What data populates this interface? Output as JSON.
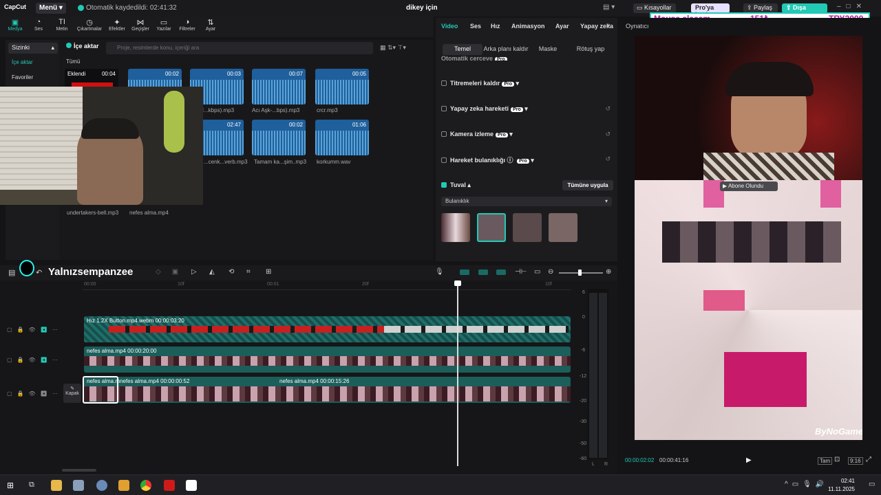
{
  "app": {
    "logo": "CapCut",
    "menu_label": "Menü",
    "autosave": "Otomatik kaydedildi: 02:41:32",
    "project_title": "dikey için"
  },
  "toolbar": {
    "items": [
      "Medya",
      "Ses",
      "Metin",
      "Çıkartmalar",
      "Efektler",
      "Geçişler",
      "Yazılar",
      "Filtreler",
      "Ayar"
    ]
  },
  "leftnav": {
    "selected": "Sizinki",
    "items": [
      "İçe aktar",
      "Favoriler"
    ]
  },
  "media": {
    "import_label": "İçe aktar",
    "search_placeholder": "Proje, resimlerde konu, içeriği ara",
    "filter_all": "Tümü",
    "items": [
      {
        "name": "",
        "duration": "00:04",
        "added": "Eklendi"
      },
      {
        "name": "...on I...kbps).mp3",
        "duration": "00:02"
      },
      {
        "name": "",
        "duration": "00:03"
      },
      {
        "name": "Acı Aşk-...bps).mp3",
        "duration": "00:07"
      },
      {
        "name": "crcr.mp3",
        "duration": "00:05"
      },
      {
        "name": "...cenk...verb.mp3",
        "duration": "02:47"
      },
      {
        "name": "Tamam ka...şim..mp3",
        "duration": "00:02"
      },
      {
        "name": "korkumm.wav",
        "duration": "01:06"
      },
      {
        "name": "undertakers-bell.mp3",
        "duration": ""
      },
      {
        "name": "nefes alma.mp4",
        "duration": ""
      }
    ]
  },
  "right": {
    "tabs": [
      "Video",
      "Ses",
      "Hız",
      "Animasyon",
      "Ayar",
      "Yapay zeka"
    ],
    "subtabs": [
      "Temel",
      "Arka planı kaldır",
      "Maske",
      "Rötuş yap"
    ],
    "options": [
      "Otomatik çerçeve",
      "Titremeleri kaldır",
      "Yapay zeka hareketi",
      "Kamera izleme",
      "Hareket bulanıklığı",
      "Tuval"
    ],
    "pro_badge": "Pro",
    "apply_all": "Tümüne uygula",
    "canvas_select": "Bulanıklık"
  },
  "topright": {
    "shortcuts": "Kısayollar",
    "pro_join": "Pro'ya katıl",
    "share": "Paylaş",
    "export": "Dışa Aktar",
    "player_label": "Oynatıcı"
  },
  "donation_banner": {
    "text": "Mouse alacam",
    "amount": "151₺",
    "goal": "TRY2000"
  },
  "preview": {
    "subscribe_label": "Abone Olundu",
    "watermark": "ByNoGame",
    "current_time": "00:00:02:02",
    "total_time": "00:00:41:16",
    "full_label": "Tam",
    "ratio": "9:16"
  },
  "streamer_name": "Yalnızsempanzee",
  "timeline": {
    "ruler": [
      "00:00",
      "10f",
      "00:01",
      "20f",
      "10f"
    ],
    "tracks": [
      {
        "label": "Hız 1.2X  Button.mp4.webm  00:00:03:20"
      },
      {
        "label": "nefes alma.mp4  00:00:20:00"
      },
      {
        "label": "nefes alma.mp4  00:00:00:52",
        "label2": "nefes alma.mp4  00:00:15:26",
        "label0": "nefes alma.m"
      }
    ],
    "cover_label": "Kapak",
    "meter_ticks": [
      "6",
      "0",
      "-6",
      "-12",
      "-20",
      "-30",
      "-50",
      "-60"
    ],
    "meter_lr": [
      "L",
      "R"
    ]
  },
  "taskbar": {
    "time": "02:41",
    "date": "11.11.2025"
  }
}
